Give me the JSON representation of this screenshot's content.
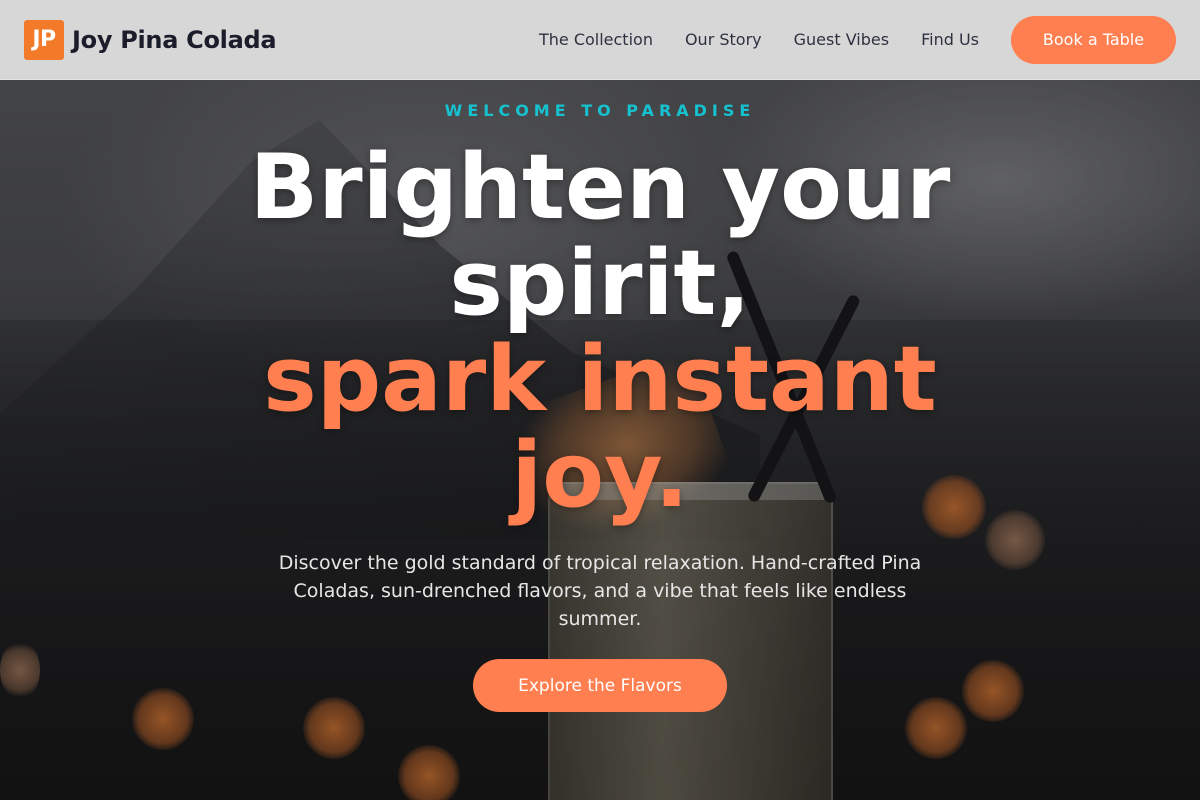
{
  "brand": {
    "logo_text": "JP",
    "name": "Joy Pina Colada"
  },
  "nav": {
    "links": [
      {
        "label": "The Collection"
      },
      {
        "label": "Our Story"
      },
      {
        "label": "Guest Vibes"
      },
      {
        "label": "Find Us"
      }
    ],
    "cta_label": "Book a Table"
  },
  "hero": {
    "eyebrow": "WELCOME TO PARADISE",
    "headline_line1": "Brighten your spirit,",
    "headline_accent": "spark instant joy.",
    "subtext": "Discover the gold standard of tropical relaxation. Hand-crafted Pina Coladas, sun-drenched flavors, and a vibe that feels like endless summer.",
    "cta_label": "Explore the Flavors"
  },
  "colors": {
    "accent": "#ff7f50",
    "logo": "#f27a28",
    "eyebrow": "#16c2d0",
    "navbar": "#dcdcdc",
    "brand_text": "#1b1d2a"
  }
}
